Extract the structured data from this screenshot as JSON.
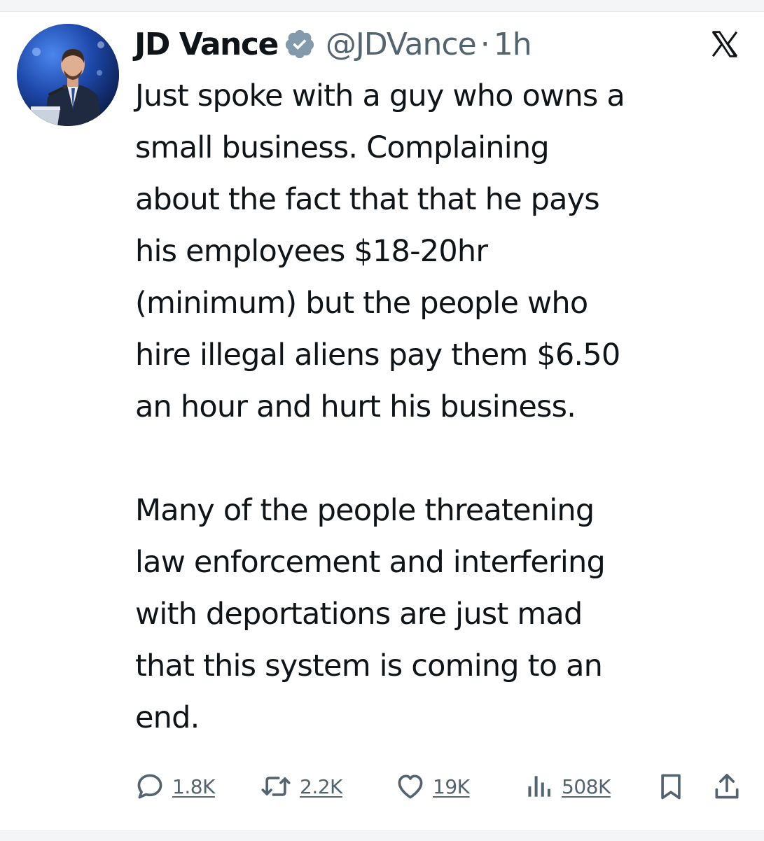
{
  "author": {
    "display_name": "JD Vance",
    "handle": "@JDVance",
    "separator": "·",
    "timestamp": "1h",
    "verified": true
  },
  "platform_logo": "x-logo",
  "tweet": {
    "paragraph1": [
      "Just spoke with a guy who owns a",
      "small business. Complaining",
      "about the fact that that he pays",
      "his employees $18-20hr",
      "(minimum) but the people who",
      "hire illegal aliens pay them $6.50",
      "an hour and hurt his business."
    ],
    "paragraph2": [
      "Many of the people threatening",
      "law enforcement and interfering",
      "with deportations are just mad",
      "that this system is coming to an",
      "end."
    ]
  },
  "actions": {
    "replies": {
      "icon": "reply-icon",
      "count": "1.8K"
    },
    "reposts": {
      "icon": "repost-icon",
      "count": "2.2K"
    },
    "likes": {
      "icon": "heart-icon",
      "count": "19K"
    },
    "views": {
      "icon": "views-icon",
      "count": "508K"
    },
    "bookmark": {
      "icon": "bookmark-icon"
    },
    "share": {
      "icon": "share-icon"
    }
  },
  "colors": {
    "text_primary": "#0f1419",
    "text_secondary": "#536471",
    "verified_badge": "#829aab"
  }
}
